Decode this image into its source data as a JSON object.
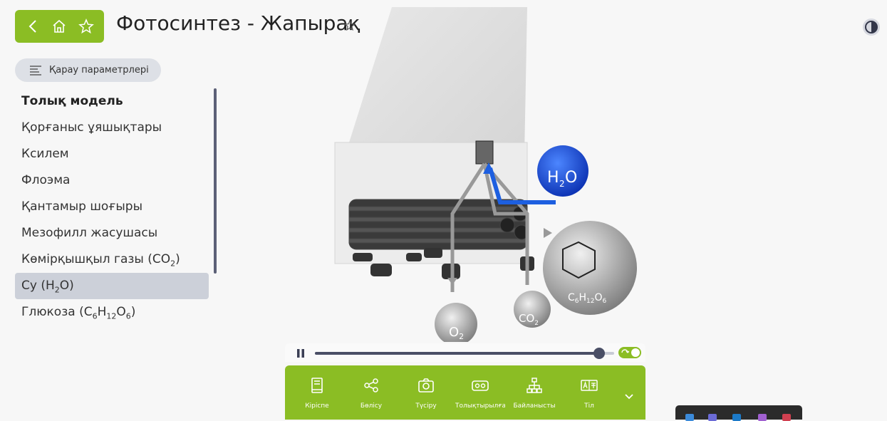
{
  "header": {
    "title": "Фотосинтез - Жапырақ"
  },
  "view_params": {
    "label": "Қарау параметрлері"
  },
  "layers": [
    {
      "label": "Толық модель",
      "bold": true
    },
    {
      "label": "Қорғаныс ұяшықтары"
    },
    {
      "label": "Ксилем"
    },
    {
      "label": "Флоэма"
    },
    {
      "label": "Қантамыр шоғыры"
    },
    {
      "label": "Мезофилл жасушасы"
    },
    {
      "label": "Көмірқышқыл газы (CO₂)",
      "prefix": "Көмірқышқыл газы (CO",
      "sub": "2",
      "suffix": ")"
    },
    {
      "label": "Су (H₂O)",
      "prefix": "Су (H",
      "sub": "2",
      "suffix": "O)",
      "selected": true
    },
    {
      "label": "Глюкоза (C₆H₁₂O₆)",
      "prefix": "Глюкоза (C",
      "sub": "6",
      "mid1": "H",
      "sub2": "12",
      "mid2": "O",
      "sub3": "6",
      "suffix": ")"
    }
  ],
  "scene": {
    "h2o": {
      "main": "H",
      "sub": "2",
      "tail": "O"
    },
    "o2": {
      "main": "O",
      "sub": "2"
    },
    "co2": {
      "main": "CO",
      "sub": "2"
    },
    "glucose": {
      "c": "C",
      "c_sub": "6",
      "h": "H",
      "h_sub": "12",
      "o": "O",
      "o_sub": "6"
    }
  },
  "player": {
    "progress": 0.95,
    "loop_enabled": true
  },
  "toolbar": {
    "items": [
      {
        "label": "Кіріспе",
        "icon": "book-icon"
      },
      {
        "label": "Бөлісу",
        "icon": "share-icon"
      },
      {
        "label": "Түсіру",
        "icon": "camera-icon"
      },
      {
        "label": "Толықтырылған шындық",
        "icon": "vr-glasses-icon"
      },
      {
        "label": "Байланысты",
        "icon": "hierarchy-icon"
      },
      {
        "label": "Тіл",
        "icon": "language-icon"
      }
    ]
  },
  "colors": {
    "accent": "#8bbd24",
    "selected_bg": "#ccd0d9",
    "h2o_blue": "#1d5fe0"
  }
}
